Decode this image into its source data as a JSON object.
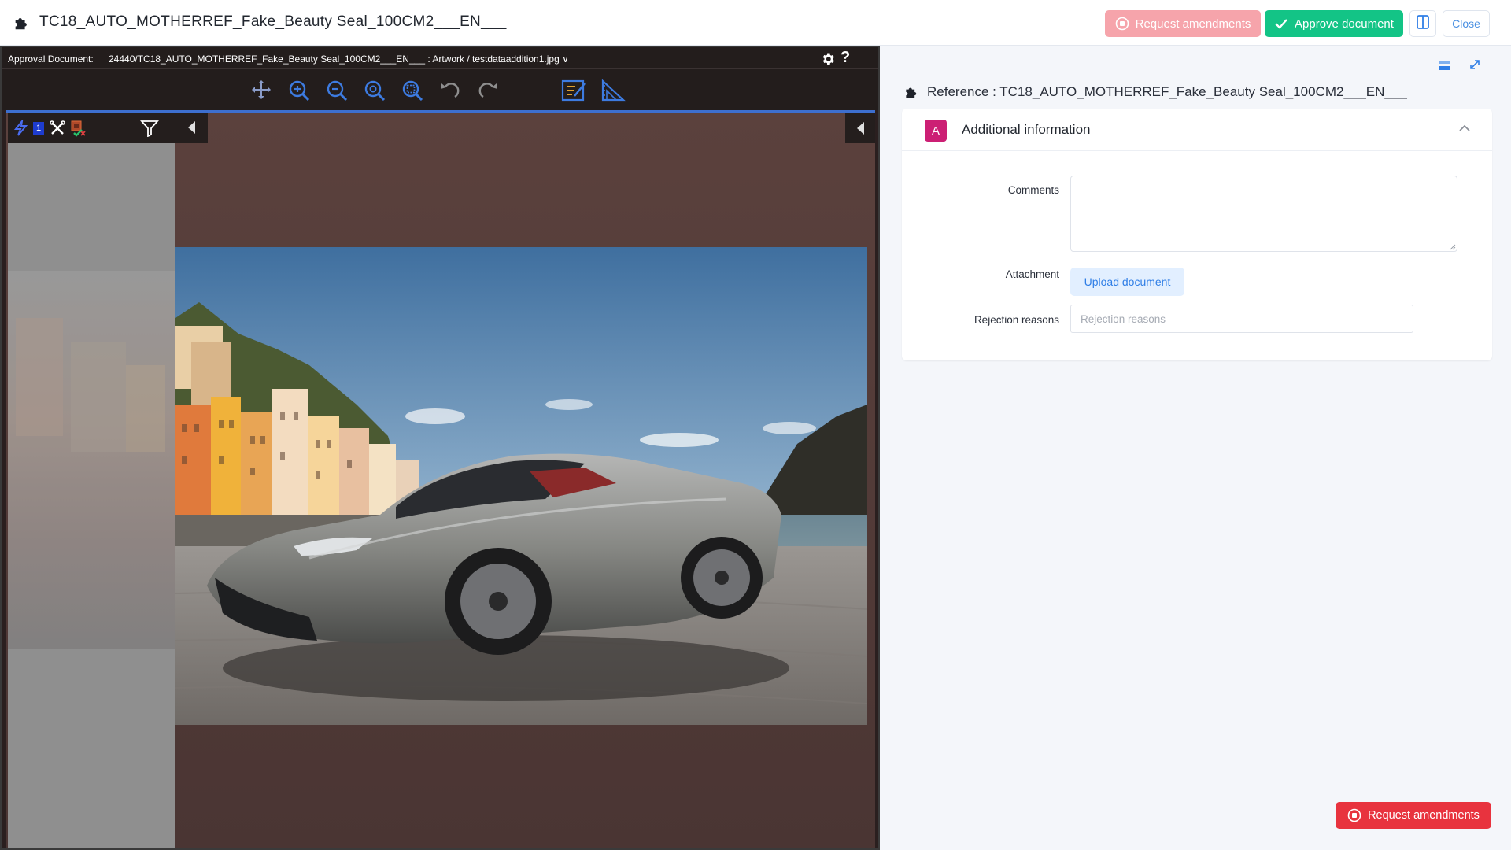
{
  "topbar": {
    "title": "TC18_AUTO_MOTHERREF_Fake_Beauty Seal_100CM2___EN___",
    "request_amendments_label": "Request amendments",
    "approve_label": "Approve document",
    "close_label": "Close"
  },
  "viewer": {
    "approval_label": "Approval Document:",
    "document_path": "24440/TC18_AUTO_MOTHERREF_Fake_Beauty Seal_100CM2___EN___ : Artwork / testdataaddition1.jpg",
    "help_label": "?",
    "annotation_count": "1",
    "toolbar_icons": [
      "move-icon",
      "zoom-in-icon",
      "zoom-out-icon",
      "zoom-fit-icon",
      "zoom-area-icon",
      "undo-icon",
      "redo-icon",
      "annotate-icon",
      "measure-icon"
    ]
  },
  "panel": {
    "reference_label": "Reference : TC18_AUTO_MOTHERREF_Fake_Beauty Seal_100CM2___EN___",
    "section_avatar": "A",
    "section_title": "Additional information",
    "comments_label": "Comments",
    "attachment_label": "Attachment",
    "upload_label": "Upload document",
    "rejection_label": "Rejection reasons",
    "rejection_placeholder": "Rejection reasons"
  },
  "footer": {
    "request_amendments_label": "Request amendments"
  },
  "colors": {
    "approve_green": "#13c486",
    "request_red": "#e8333e",
    "request_red_light": "#f6a4ab",
    "accent_blue": "#2f7ee6",
    "avatar_magenta": "#cc1f74"
  }
}
